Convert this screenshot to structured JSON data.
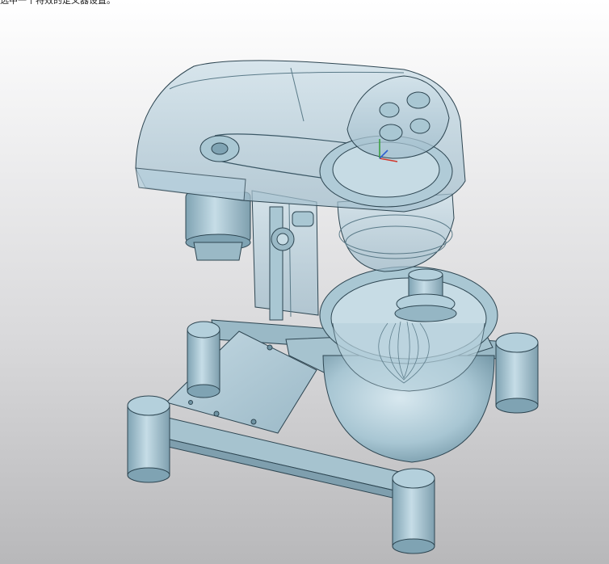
{
  "viewport": {
    "status_text": "选中一个特效的定义器设置。",
    "model_name": "",
    "colors": {
      "background_top": "#ffffff",
      "background_bottom": "#b8b8ba",
      "solid_body": "#a9c7d3",
      "solid_dark": "#6f93a3",
      "glass": "#b6cfdc",
      "edge": "#2e4652"
    }
  }
}
